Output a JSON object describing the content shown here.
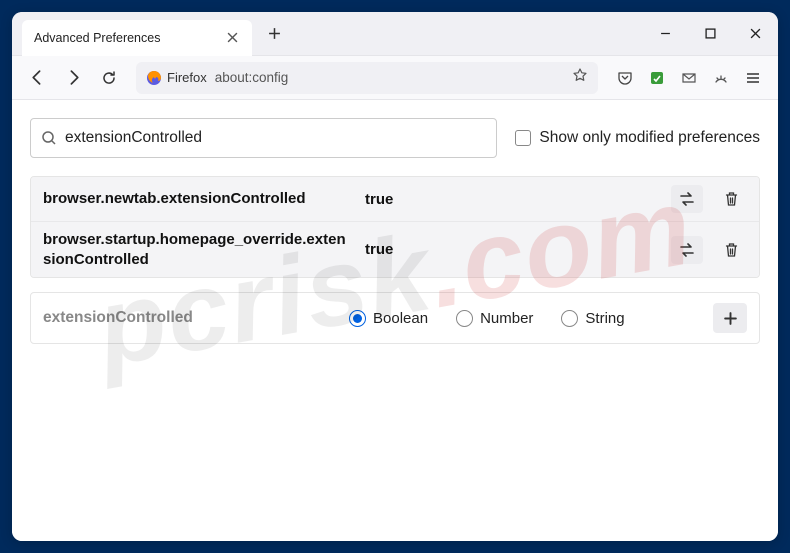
{
  "tab": {
    "title": "Advanced Preferences"
  },
  "url": {
    "brand": "Firefox",
    "address": "about:config"
  },
  "search": {
    "value": "extensionControlled"
  },
  "filter": {
    "label": "Show only modified preferences",
    "checked": false
  },
  "prefs": [
    {
      "name": "browser.newtab.extensionControlled",
      "value": "true"
    },
    {
      "name": "browser.startup.homepage_override.extensionControlled",
      "value": "true"
    }
  ],
  "newPref": {
    "name": "extensionControlled",
    "types": [
      {
        "label": "Boolean",
        "selected": true
      },
      {
        "label": "Number",
        "selected": false
      },
      {
        "label": "String",
        "selected": false
      }
    ]
  },
  "watermark": {
    "text": "pcrisk",
    "tld": ".com"
  }
}
